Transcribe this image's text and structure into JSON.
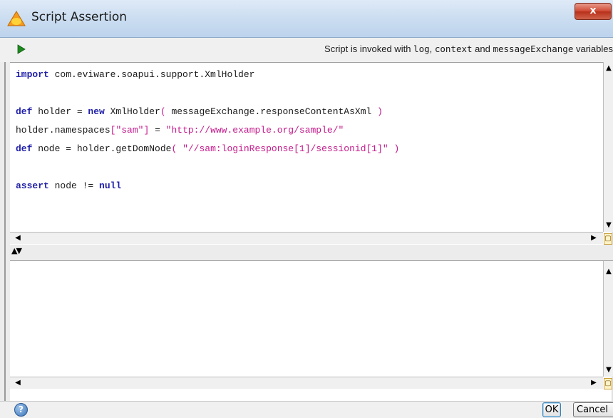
{
  "window": {
    "title": "Script Assertion",
    "close_label": "x"
  },
  "toolbar": {
    "run_icon": "play-icon",
    "hint_prefix": "Script is invoked with ",
    "hint_log": "log",
    "hint_sep1": ", ",
    "hint_context": "context",
    "hint_sep2": " and ",
    "hint_exchange": "messageExchange",
    "hint_suffix": " variables"
  },
  "editor": {
    "lines": [
      {
        "kw1": "import",
        "rest": " com.eviware.soapui.support.XmlHolder"
      },
      {},
      {
        "kw1": "def",
        "a": " holder = ",
        "kw2": "new",
        "b": " XmlHolder",
        "br_open": "(",
        "c": " messageExchange.responseContentAsXml ",
        "br_close": ")"
      },
      {
        "a": "holder.namespaces",
        "br_open": "[",
        "str1": "\"sam\"",
        "br_close": "]",
        "b": " = ",
        "str2": "\"http://www.example.org/sample/\""
      },
      {
        "kw1": "def",
        "a": " node = holder.getDomNode",
        "br_open": "(",
        "str1": " \"//sam:loginResponse[1]/sessionid[1]\" ",
        "br_close": ")"
      },
      {},
      {
        "kw1": "assert",
        "a": " node != ",
        "kw2": "null"
      }
    ]
  },
  "splitter": {
    "icon": "collapse-expand-icon",
    "glyph": "▲▼"
  },
  "scroll_arrows": {
    "up": "▲",
    "down": "▼",
    "left": "◀",
    "right": "▶",
    "corner": "▢"
  },
  "footer": {
    "help_icon": "help-icon",
    "help_glyph": "?",
    "ok_label": "OK",
    "cancel_label": "Cancel"
  },
  "colors": {
    "keyword": "#1f1fa8",
    "string": "#c41a8c",
    "titlebar": "#c9dcf0",
    "close": "#cf4b35"
  }
}
